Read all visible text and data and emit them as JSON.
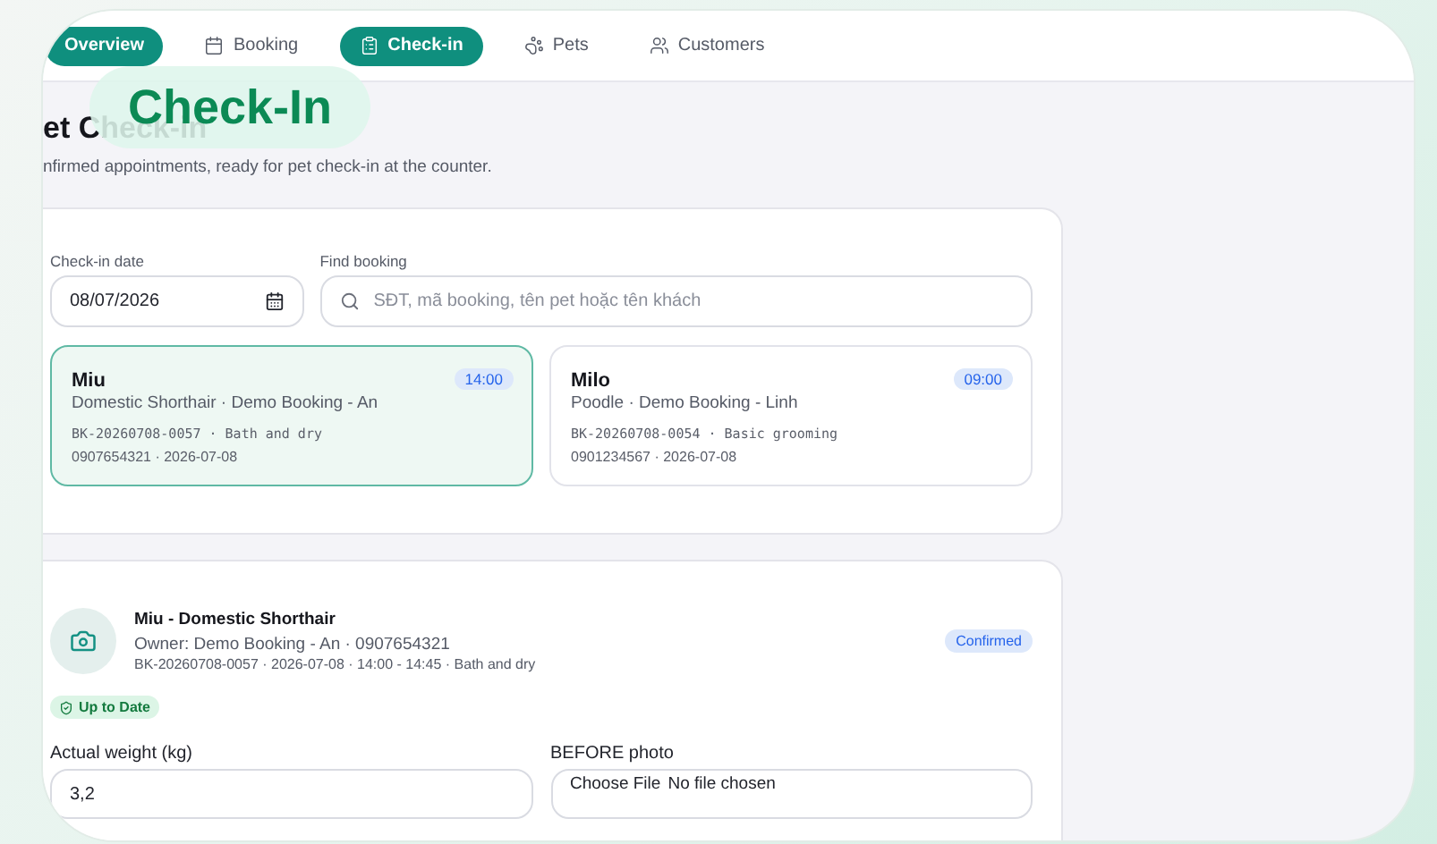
{
  "nav": {
    "tabs": [
      {
        "label": "Overview",
        "selected": true
      },
      {
        "label": "Booking",
        "selected": false
      },
      {
        "label": "Check-in",
        "selected": true
      },
      {
        "label": "Pets",
        "selected": false
      },
      {
        "label": "Customers",
        "selected": false
      }
    ]
  },
  "overlay_badge": "Check-In",
  "page": {
    "title": "et Check-in",
    "subtitle": "nfirmed appointments, ready for pet check-in at the counter."
  },
  "filters": {
    "date": {
      "label": "Check-in date",
      "value": "08/07/2026"
    },
    "search": {
      "label": "Find booking",
      "placeholder": "SĐT, mã booking, tên pet hoặc tên khách"
    }
  },
  "bookings": [
    {
      "name": "Miu",
      "time": "14:00",
      "detail": "Domestic Shorthair · Demo Booking - An",
      "code": "BK-20260708-0057 · Bath and dry",
      "contact": "0907654321 · 2026-07-08",
      "selected": true
    },
    {
      "name": "Milo",
      "time": "09:00",
      "detail": "Poodle · Demo Booking - Linh",
      "code": "BK-20260708-0054 · Basic grooming",
      "contact": "0901234567 · 2026-07-08",
      "selected": false
    }
  ],
  "checkin": {
    "title": "Miu - Domestic Shorthair",
    "owner": "Owner: Demo Booking - An · 0907654321",
    "ref": "BK-20260708-0057 · 2026-07-08 · 14:00 - 14:45 · Bath and dry",
    "status": "Confirmed",
    "vaccine": "Up to Date",
    "weight": {
      "label": "Actual weight (kg)",
      "value": "3,2"
    },
    "photo": {
      "label": "BEFORE photo",
      "button": "Choose File",
      "status": "No file chosen"
    }
  }
}
